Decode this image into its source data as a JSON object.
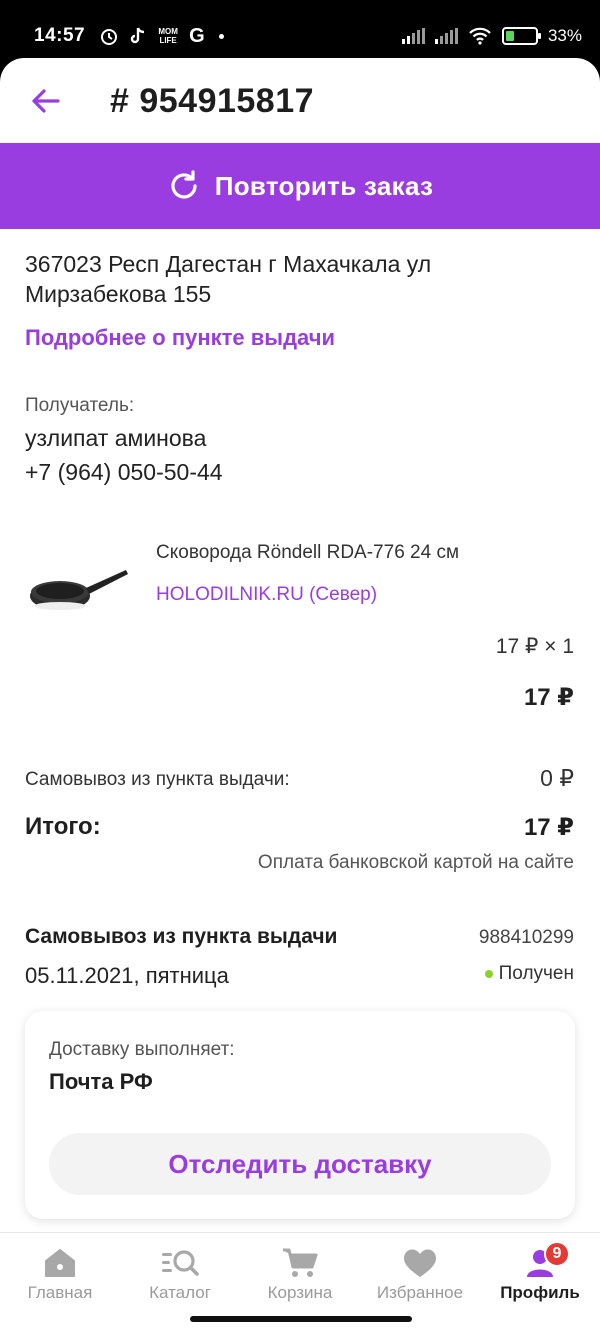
{
  "status_bar": {
    "time": "14:57",
    "battery_percent": "33%",
    "battery_level": 0.33,
    "app_icons": [
      "alarm-icon",
      "tiktok-icon",
      "mom-life-icon",
      "google-icon",
      "dot-icon"
    ],
    "app_icon_text": {
      "mom_life": "MOM LIFE",
      "google": "G"
    }
  },
  "header": {
    "order_number": "# 954915817",
    "back_icon": "arrow-left-icon"
  },
  "repeat_order": {
    "label": "Повторить заказ",
    "icon": "refresh-icon"
  },
  "pickup_point": {
    "address": " 367023 Респ Дагестан г Махачкала ул\nМирзабекова 155",
    "more_link": "Подробнее о пункте выдачи"
  },
  "recipient": {
    "label": "Получатель:",
    "name": "узлипат аминова",
    "phone": "+7 (964) 050-50-44"
  },
  "product": {
    "name": "Сковорода Röndell RDA-776 24 см",
    "seller": "HOLODILNIK.RU (Север)",
    "qty_line": "17 ₽ × 1",
    "sum": "17 ₽"
  },
  "summary": {
    "pickup_label": "Самовывоз из пункта выдачи:",
    "pickup_price": "0 ₽",
    "total_label": "Итого:",
    "total_value": "17 ₽",
    "payment_note": "Оплата банковской картой на сайте"
  },
  "shipment": {
    "title": "Самовывоз из пункта выдачи",
    "number": "988410299",
    "date": "05.11.2021, пятница",
    "status": "Получен",
    "status_color": "#8bd12a"
  },
  "delivery_card": {
    "label": "Доставку выполняет:",
    "carrier": "Почта РФ",
    "track_button": "Отследить доставку"
  },
  "bottom_nav": {
    "items": [
      {
        "label": "Главная",
        "icon": "home-icon"
      },
      {
        "label": "Каталог",
        "icon": "catalog-search-icon"
      },
      {
        "label": "Корзина",
        "icon": "cart-icon"
      },
      {
        "label": "Избранное",
        "icon": "heart-icon"
      },
      {
        "label": "Профиль",
        "icon": "profile-icon",
        "badge": "9",
        "active": true
      }
    ]
  },
  "colors": {
    "accent": "#9a3de0",
    "badge": "#e53935",
    "status_ok": "#8bd12a"
  }
}
